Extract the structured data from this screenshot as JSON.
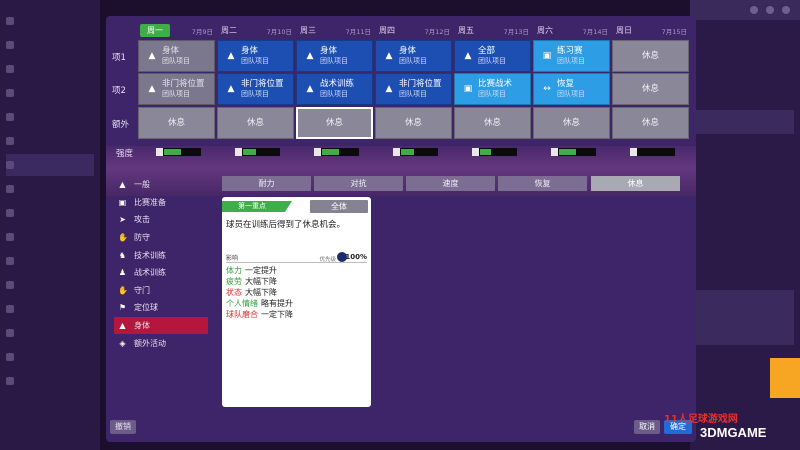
{
  "schedule": {
    "days": [
      {
        "name": "周一",
        "date": "7月9日",
        "today": true
      },
      {
        "name": "周二",
        "date": "7月10日"
      },
      {
        "name": "周三",
        "date": "7月11日"
      },
      {
        "name": "周四",
        "date": "7月12日"
      },
      {
        "name": "周五",
        "date": "7月13日"
      },
      {
        "name": "周六",
        "date": "7月14日"
      },
      {
        "name": "周日",
        "date": "7月15日"
      }
    ],
    "row_labels": [
      "项1",
      "项2",
      "额外"
    ],
    "rows": [
      [
        {
          "t1": "身体",
          "t2": "团队项目",
          "style": "dgray",
          "icon": "body-icon",
          "glyph": "▲"
        },
        {
          "t1": "身体",
          "t2": "团队项目",
          "style": "blue",
          "icon": "body-icon",
          "glyph": "▲"
        },
        {
          "t1": "身体",
          "t2": "团队项目",
          "style": "blue",
          "icon": "body-icon",
          "glyph": "▲"
        },
        {
          "t1": "身体",
          "t2": "团队项目",
          "style": "blue",
          "icon": "body-icon",
          "glyph": "▲"
        },
        {
          "t1": "全部",
          "t2": "团队项目",
          "style": "blue",
          "icon": "body-icon",
          "glyph": "▲"
        },
        {
          "t1": "练习赛",
          "t2": "团队项目",
          "style": "cyan",
          "icon": "match-icon",
          "glyph": "▣"
        },
        {
          "t1": "休息",
          "t2": "",
          "style": "gray",
          "icon": "",
          "glyph": ""
        }
      ],
      [
        {
          "t1": "非门将位置",
          "t2": "团队项目",
          "style": "dgray",
          "icon": "position-icon",
          "glyph": "▲"
        },
        {
          "t1": "非门将位置",
          "t2": "团队项目",
          "style": "blue",
          "icon": "position-icon",
          "glyph": "▲"
        },
        {
          "t1": "战术训练",
          "t2": "团队项目",
          "style": "blue",
          "icon": "tactics-icon",
          "glyph": "▲"
        },
        {
          "t1": "非门将位置",
          "t2": "团队项目",
          "style": "blue",
          "icon": "position-icon",
          "glyph": "▲"
        },
        {
          "t1": "比赛战术",
          "t2": "团队项目",
          "style": "cyan",
          "icon": "match-prep-icon",
          "glyph": "▣"
        },
        {
          "t1": "恢复",
          "t2": "团队项目",
          "style": "cyan",
          "icon": "recovery-icon",
          "glyph": "↔"
        },
        {
          "t1": "休息",
          "t2": "",
          "style": "gray",
          "icon": "",
          "glyph": ""
        }
      ],
      [
        {
          "t1": "休息",
          "style": "gray"
        },
        {
          "t1": "休息",
          "style": "gray"
        },
        {
          "t1": "休息",
          "style": "gray",
          "selected": true
        },
        {
          "t1": "休息",
          "style": "gray"
        },
        {
          "t1": "休息",
          "style": "gray"
        },
        {
          "t1": "休息",
          "style": "gray"
        },
        {
          "t1": "休息",
          "style": "gray"
        }
      ]
    ]
  },
  "intensity": {
    "label": "强度",
    "levels": [
      0.45,
      0.35,
      0.45,
      0.35,
      0.3,
      0.45,
      0.0
    ]
  },
  "categories": [
    {
      "label": "一般",
      "icon": "general-icon",
      "glyph": "▲"
    },
    {
      "label": "比赛准备",
      "icon": "match-prep-icon",
      "glyph": "▣"
    },
    {
      "label": "攻击",
      "icon": "attack-icon",
      "glyph": "➤"
    },
    {
      "label": "防守",
      "icon": "defend-icon",
      "glyph": "✋"
    },
    {
      "label": "技术训练",
      "icon": "technical-icon",
      "glyph": "♞"
    },
    {
      "label": "战术训练",
      "icon": "tactics-icon",
      "glyph": "♟"
    },
    {
      "label": "守门",
      "icon": "goalkeeper-icon",
      "glyph": "✋"
    },
    {
      "label": "定位球",
      "icon": "set-piece-icon",
      "glyph": "⚑"
    },
    {
      "label": "身体",
      "icon": "body-icon",
      "glyph": "▲",
      "active": true
    },
    {
      "label": "额外活动",
      "icon": "extra-activity-icon",
      "glyph": "◈"
    }
  ],
  "tabs": [
    {
      "label": "耐力"
    },
    {
      "label": "对抗"
    },
    {
      "label": "速度"
    },
    {
      "label": "恢复"
    },
    {
      "label": "休息",
      "active": true
    }
  ],
  "card": {
    "badge": "第一重点",
    "scope": "全体",
    "description": "球员在训练后得到了休息机会。",
    "impact_label": "影响",
    "priority_label": "优先级",
    "priority_value": "100%",
    "effects": [
      {
        "key": "体力",
        "value": "一定提升",
        "color": "green"
      },
      {
        "key": "疲劳",
        "value": "大幅下降",
        "color": "green"
      },
      {
        "key": "状态",
        "value": "大幅下降",
        "color": "red"
      },
      {
        "key": "个人情绪",
        "value": "略有提升",
        "color": "green"
      },
      {
        "key": "球队磨合",
        "value": "一定下降",
        "color": "red"
      }
    ]
  },
  "footer": {
    "undo": "撤销",
    "cancel": "取消",
    "confirm": "确定"
  },
  "watermark": {
    "line1": "11人足球游戏网",
    "line2": "3DMGAME"
  }
}
